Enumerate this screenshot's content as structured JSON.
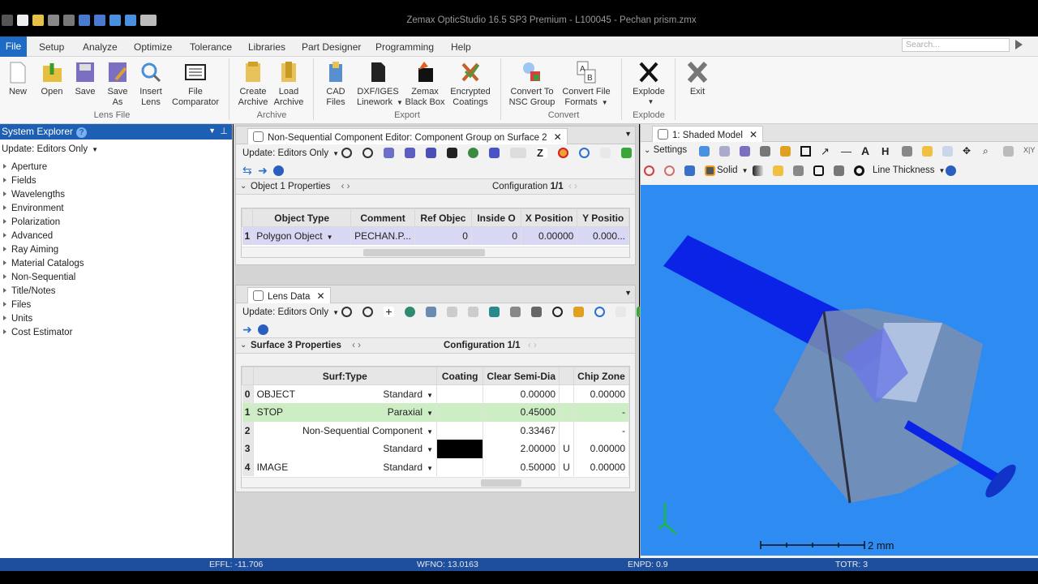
{
  "app": {
    "window_title": "Zemax OpticStudio 16.5 SP3   Premium - L100045 - Pechan prism.zmx"
  },
  "menu": {
    "file": "File",
    "items": [
      "Setup",
      "Analyze",
      "Optimize",
      "Tolerance",
      "Libraries",
      "Part Designer",
      "Programming",
      "Help"
    ],
    "search_placeholder": "Search..."
  },
  "ribbon": {
    "buttons": {
      "new": "New",
      "open": "Open",
      "save": "Save",
      "save_as_1": "Save",
      "save_as_2": "As",
      "insert_1": "Insert",
      "insert_2": "Lens",
      "filecomp_1": "File",
      "filecomp_2": "Comparator",
      "create_1": "Create",
      "create_2": "Archive",
      "load_1": "Load",
      "load_2": "Archive",
      "cad_1": "CAD",
      "cad_2": "Files",
      "dxf_1": "DXF/IGES",
      "dxf_2": "Linework",
      "blackbox_1": "Zemax",
      "blackbox_2": "Black Box",
      "enc_1": "Encrypted",
      "enc_2": "Coatings",
      "nsc_1": "Convert To",
      "nsc_2": "NSC Group",
      "cff_1": "Convert File",
      "cff_2": "Formats",
      "explode": "Explode",
      "exit": "Exit"
    },
    "groups": {
      "lens_file": "Lens File",
      "archive": "Archive",
      "export": "Export",
      "convert": "Convert",
      "explode": "Explode"
    }
  },
  "system_explorer": {
    "title": "System Explorer",
    "update": "Update: Editors Only",
    "items": [
      "Aperture",
      "Fields",
      "Wavelengths",
      "Environment",
      "Polarization",
      "Advanced",
      "Ray Aiming",
      "Material Catalogs",
      "Non-Sequential",
      "Title/Notes",
      "Files",
      "Units",
      "Cost Estimator"
    ]
  },
  "nsc_editor": {
    "tab": "Non-Sequential Component Editor: Component Group on Surface 2",
    "update": "Update: Editors Only",
    "section": "Object 1 Properties",
    "configuration_label": "Configuration",
    "configuration_value": "1/1",
    "columns": [
      "Object Type",
      "Comment",
      "Ref Objec",
      "Inside O",
      "X Position",
      "Y Positio"
    ],
    "rows": [
      {
        "n": "1",
        "type": "Polygon Object",
        "comment": "PECHAN.P...",
        "ref": "0",
        "inside": "0",
        "x": "0.00000",
        "y": "0.000..."
      }
    ]
  },
  "lens_data": {
    "tab": "Lens Data",
    "update": "Update: Editors Only",
    "section": "Surface 3 Properties",
    "configuration_label": "Configuration",
    "configuration_value": "1/1",
    "columns": [
      "Surf:Type",
      "Coating",
      "Clear Semi-Dia",
      "Chip Zone"
    ],
    "rows": [
      {
        "n": "0",
        "name": "OBJECT",
        "type": "Standard",
        "semi": "0.00000",
        "flag": "",
        "chip": "0.00000"
      },
      {
        "n": "1",
        "name": "STOP",
        "type": "Paraxial",
        "semi": "0.45000",
        "flag": "",
        "chip": "-"
      },
      {
        "n": "2",
        "name": "",
        "type": "Non-Sequential Component",
        "semi": "0.33467",
        "flag": "",
        "chip": "-"
      },
      {
        "n": "3",
        "name": "",
        "type": "Standard",
        "semi": "2.00000",
        "flag": "U",
        "chip": "0.00000"
      },
      {
        "n": "4",
        "name": "IMAGE",
        "type": "Standard",
        "semi": "0.50000",
        "flag": "U",
        "chip": "0.00000"
      }
    ]
  },
  "viewer": {
    "tab": "1: Shaded Model",
    "settings": "Settings",
    "solid": "Solid",
    "line_thickness": "Line Thickness",
    "scale_label": "2 mm"
  },
  "status": {
    "effl": "EFFL: -11.706",
    "wfno": "WFNO: 13.0163",
    "enpd": "ENPD: 0.9",
    "totr": "TOTR: 3"
  },
  "colors": {
    "accent_blue": "#1e6bc4",
    "status_blue": "#1e4f9e",
    "viewport_blue": "#2d8bf2",
    "stop_green": "#cdeec4",
    "selected_row": "#d8d8f5"
  }
}
